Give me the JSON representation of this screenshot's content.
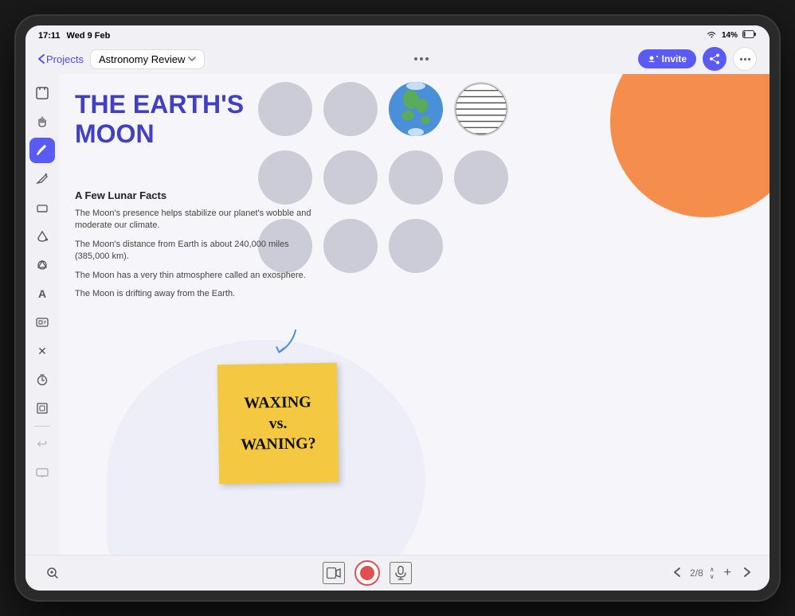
{
  "status_bar": {
    "time": "17:11",
    "date": "Wed 9 Feb",
    "battery": "14%",
    "wifi": true
  },
  "nav": {
    "back_label": "Projects",
    "tab_label": "Astronomy Review",
    "more_dots": "...",
    "invite_label": "Invite",
    "share_icon": "share",
    "options_icon": "more"
  },
  "toolbar": {
    "tools": [
      {
        "name": "crop-tool",
        "icon": "⊡",
        "label": "Select"
      },
      {
        "name": "hand-tool",
        "icon": "✋",
        "label": "Hand"
      },
      {
        "name": "pen-tool",
        "icon": "✏️",
        "label": "Pen",
        "active": true
      },
      {
        "name": "pencil-tool",
        "icon": "✎",
        "label": "Pencil"
      },
      {
        "name": "eraser-tool",
        "icon": "◻",
        "label": "Eraser"
      },
      {
        "name": "fill-tool",
        "icon": "◉",
        "label": "Fill"
      },
      {
        "name": "shapes-tool",
        "icon": "⬡",
        "label": "Shapes"
      },
      {
        "name": "text-tool",
        "icon": "A",
        "label": "Text"
      },
      {
        "name": "media-tool",
        "icon": "▣",
        "label": "Media"
      },
      {
        "name": "close-tool",
        "icon": "✕",
        "label": "Close"
      },
      {
        "name": "timer-tool",
        "icon": "⊕",
        "label": "Timer"
      },
      {
        "name": "frame-tool",
        "icon": "⬚",
        "label": "Frame"
      },
      {
        "name": "undo-tool",
        "icon": "↩",
        "label": "Undo"
      },
      {
        "name": "screen-tool",
        "icon": "⬜",
        "label": "Screen"
      }
    ]
  },
  "slide": {
    "title_line1": "THE EARTH'S",
    "title_line2": "MOON",
    "facts_title": "A Few Lunar Facts",
    "facts": [
      "The Moon's presence helps stabilize our planet's wobble and moderate our climate.",
      "The Moon's distance from Earth is about 240,000 miles (385,000 km).",
      "The Moon has a very thin atmosphere called an exosphere.",
      "The Moon is drifting away from the Earth."
    ],
    "sticky_text": "WAXING\nvs.\nWANING?",
    "orange_deco": "#f5823a",
    "title_color": "#3535c0"
  },
  "bottom_bar": {
    "zoom_icon": "🔍",
    "video_icon": "📹",
    "record_icon": "⏺",
    "mic_icon": "🎤",
    "prev_page": "<",
    "next_page": ">",
    "page_current": "2",
    "page_total": "8",
    "up_icon": "∧",
    "add_icon": "+",
    "nav_right_icon": ">"
  }
}
